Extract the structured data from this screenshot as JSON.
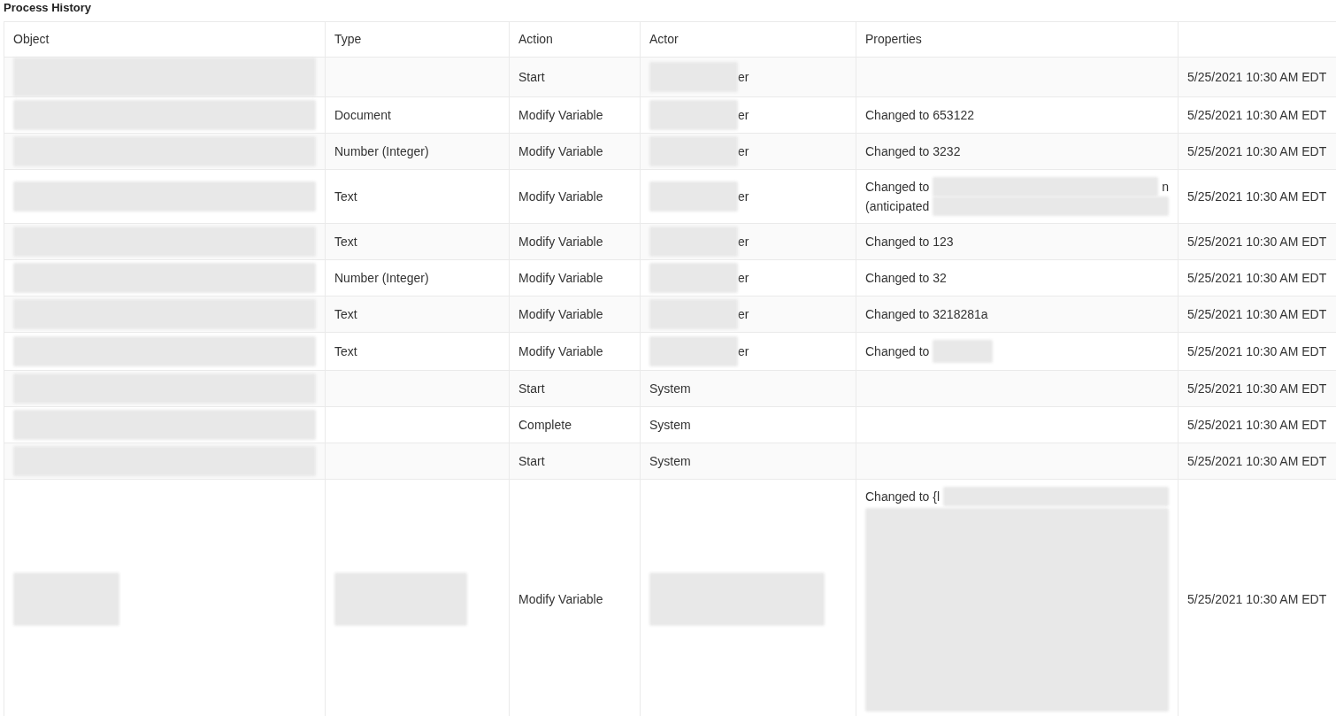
{
  "title": "Process History",
  "table": {
    "columns": [
      {
        "label": "Object"
      },
      {
        "label": "Type"
      },
      {
        "label": "Action"
      },
      {
        "label": "Actor"
      },
      {
        "label": "Properties"
      }
    ],
    "rows": [
      {
        "object": {
          "redacted": true
        },
        "type": {},
        "action": "Start",
        "actor": {
          "text": "er",
          "redacted": true
        },
        "column_6": "5/25/2021 10:30 AM EDT"
      },
      {
        "object": {
          "redacted": true
        },
        "type": {
          "text": "Document"
        },
        "action": "Modify Variable",
        "actor": {
          "text": "er",
          "redacted": true
        },
        "properties": [
          [
            {
              "kind": "text",
              "text": "Changed to 653122"
            }
          ]
        ],
        "column_6": "5/25/2021 10:30 AM EDT"
      },
      {
        "object": {
          "redacted": true
        },
        "type": {
          "text": "Number (Integer)"
        },
        "action": "Modify Variable",
        "actor": {
          "text": "er",
          "redacted": true
        },
        "properties": [
          [
            {
              "kind": "text",
              "text": "Changed to 3232"
            }
          ]
        ],
        "column_6": "5/25/2021 10:30 AM EDT"
      },
      {
        "object": {
          "redacted": true
        },
        "type": {
          "text": "Text"
        },
        "action": "Modify Variable",
        "actor": {
          "text": "er",
          "redacted": true
        },
        "properties": [
          [
            {
              "kind": "text",
              "text": "Changed to"
            },
            {
              "kind": "redaction",
              "wide": true
            },
            {
              "kind": "text",
              "text": "n"
            }
          ],
          [
            {
              "kind": "text",
              "text": "(anticipated"
            },
            {
              "kind": "redaction",
              "wide": true
            }
          ]
        ],
        "column_6": "5/25/2021 10:30 AM EDT"
      },
      {
        "object": {
          "redacted": true
        },
        "type": {
          "text": "Text"
        },
        "action": "Modify Variable",
        "actor": {
          "text": "er",
          "redacted": true
        },
        "properties": [
          [
            {
              "kind": "text",
              "text": "Changed to 123"
            }
          ]
        ],
        "column_6": "5/25/2021 10:30 AM EDT"
      },
      {
        "object": {
          "redacted": true
        },
        "type": {
          "text": "Number (Integer)"
        },
        "action": "Modify Variable",
        "actor": {
          "text": "er",
          "redacted": true
        },
        "properties": [
          [
            {
              "kind": "text",
              "text": "Changed to 32"
            }
          ]
        ],
        "column_6": "5/25/2021 10:30 AM EDT"
      },
      {
        "object": {
          "redacted": true
        },
        "type": {
          "text": "Text"
        },
        "action": "Modify Variable",
        "actor": {
          "text": "er",
          "redacted": true
        },
        "properties": [
          [
            {
              "kind": "text",
              "text": "Changed to 3218281a"
            }
          ]
        ],
        "column_6": "5/25/2021 10:30 AM EDT"
      },
      {
        "object": {
          "redacted": true
        },
        "type": {
          "text": "Text"
        },
        "action": "Modify Variable",
        "actor": {
          "text": "er",
          "redacted": true
        },
        "properties": [
          [
            {
              "kind": "text",
              "text": "Changed to"
            },
            {
              "kind": "redaction",
              "wide": false
            }
          ]
        ],
        "column_6": "5/25/2021 10:30 AM EDT"
      },
      {
        "object": {
          "redacted": true
        },
        "type": {},
        "action": "Start",
        "actor": {
          "text": "System"
        },
        "column_6": "5/25/2021 10:30 AM EDT"
      },
      {
        "object": {
          "redacted": true
        },
        "type": {},
        "action": "Complete",
        "actor": {
          "text": "System"
        },
        "column_6": "5/25/2021 10:30 AM EDT"
      },
      {
        "object": {
          "redacted": true
        },
        "type": {},
        "action": "Start",
        "actor": {
          "text": "System"
        },
        "column_6": "5/25/2021 10:30 AM EDT"
      },
      {
        "object": {
          "redacted": true
        },
        "type": {
          "redacted": true
        },
        "action": "Modify Variable",
        "actor": {
          "redacted": true
        },
        "properties": [
          [
            {
              "kind": "text",
              "text": "Changed to {l"
            },
            {
              "kind": "redaction",
              "wide": true
            }
          ],
          [
            {
              "kind": "block"
            }
          ]
        ],
        "column_6": "5/25/2021 10:30 AM EDT"
      }
    ]
  }
}
